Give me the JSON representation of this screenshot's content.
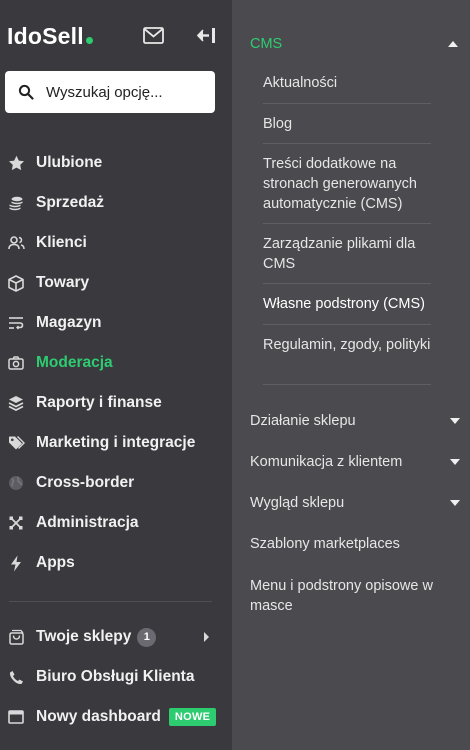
{
  "brand": {
    "logo_text": "IdoSell",
    "accent": "#2ecc71"
  },
  "search": {
    "placeholder": "Wyszukaj opcję..."
  },
  "nav": {
    "items": [
      {
        "label": "Ulubione",
        "icon": "star-icon"
      },
      {
        "label": "Sprzedaż",
        "icon": "coins-icon"
      },
      {
        "label": "Klienci",
        "icon": "users-icon"
      },
      {
        "label": "Towary",
        "icon": "box-icon"
      },
      {
        "label": "Magazyn",
        "icon": "warehouse-icon"
      },
      {
        "label": "Moderacja",
        "icon": "camera-icon",
        "active": true
      },
      {
        "label": "Raporty i finanse",
        "icon": "layers-icon"
      },
      {
        "label": "Marketing i integracje",
        "icon": "tags-icon"
      },
      {
        "label": "Cross-border",
        "icon": "globe-icon"
      },
      {
        "label": "Administracja",
        "icon": "tools-icon"
      },
      {
        "label": "Apps",
        "icon": "bolt-icon"
      }
    ],
    "bottom": [
      {
        "label": "Twoje sklepy",
        "icon": "shopping-bag-icon",
        "badge": "1"
      },
      {
        "label": "Biuro Obsługi Klienta",
        "icon": "phone-icon"
      },
      {
        "label": "Nowy dashboard",
        "icon": "window-icon",
        "badge": "NOWE"
      }
    ]
  },
  "submenu": {
    "header": "CMS",
    "items": [
      "Aktualności",
      "Blog",
      "Treści dodatkowe na stronach generowanych automatycznie (CMS)",
      "Zarządzanie plikami dla CMS",
      "Własne podstrony (CMS)",
      "Regulamin, zgody, polityki"
    ],
    "sections": [
      "Działanie sklepu",
      "Komunikacja z klientem",
      "Wygląd sklepu",
      "Szablony marketplaces",
      "Menu i podstrony opisowe w masce"
    ]
  }
}
